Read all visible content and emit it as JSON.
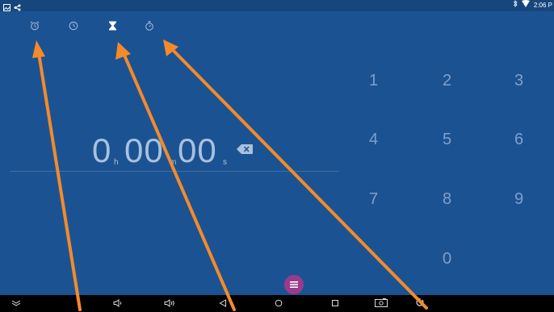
{
  "status_bar": {
    "time": "2:06 P",
    "icons": [
      "image-icon",
      "share-icon",
      "bluetooth-icon",
      "wifi-icon"
    ]
  },
  "tabs": [
    "alarm-icon",
    "clock-icon",
    "timer-icon",
    "stopwatch-icon"
  ],
  "timer": {
    "hours": "0",
    "minutes": "00",
    "seconds": "00",
    "h_unit": "h",
    "m_unit": "m",
    "s_unit": "s"
  },
  "keypad": {
    "keys": [
      "1",
      "2",
      "3",
      "4",
      "5",
      "6",
      "7",
      "8",
      "9",
      "0"
    ]
  },
  "colors": {
    "background": "#1b5392",
    "accent": "#993b8c",
    "annotation_arrow": "#f48a2a"
  }
}
